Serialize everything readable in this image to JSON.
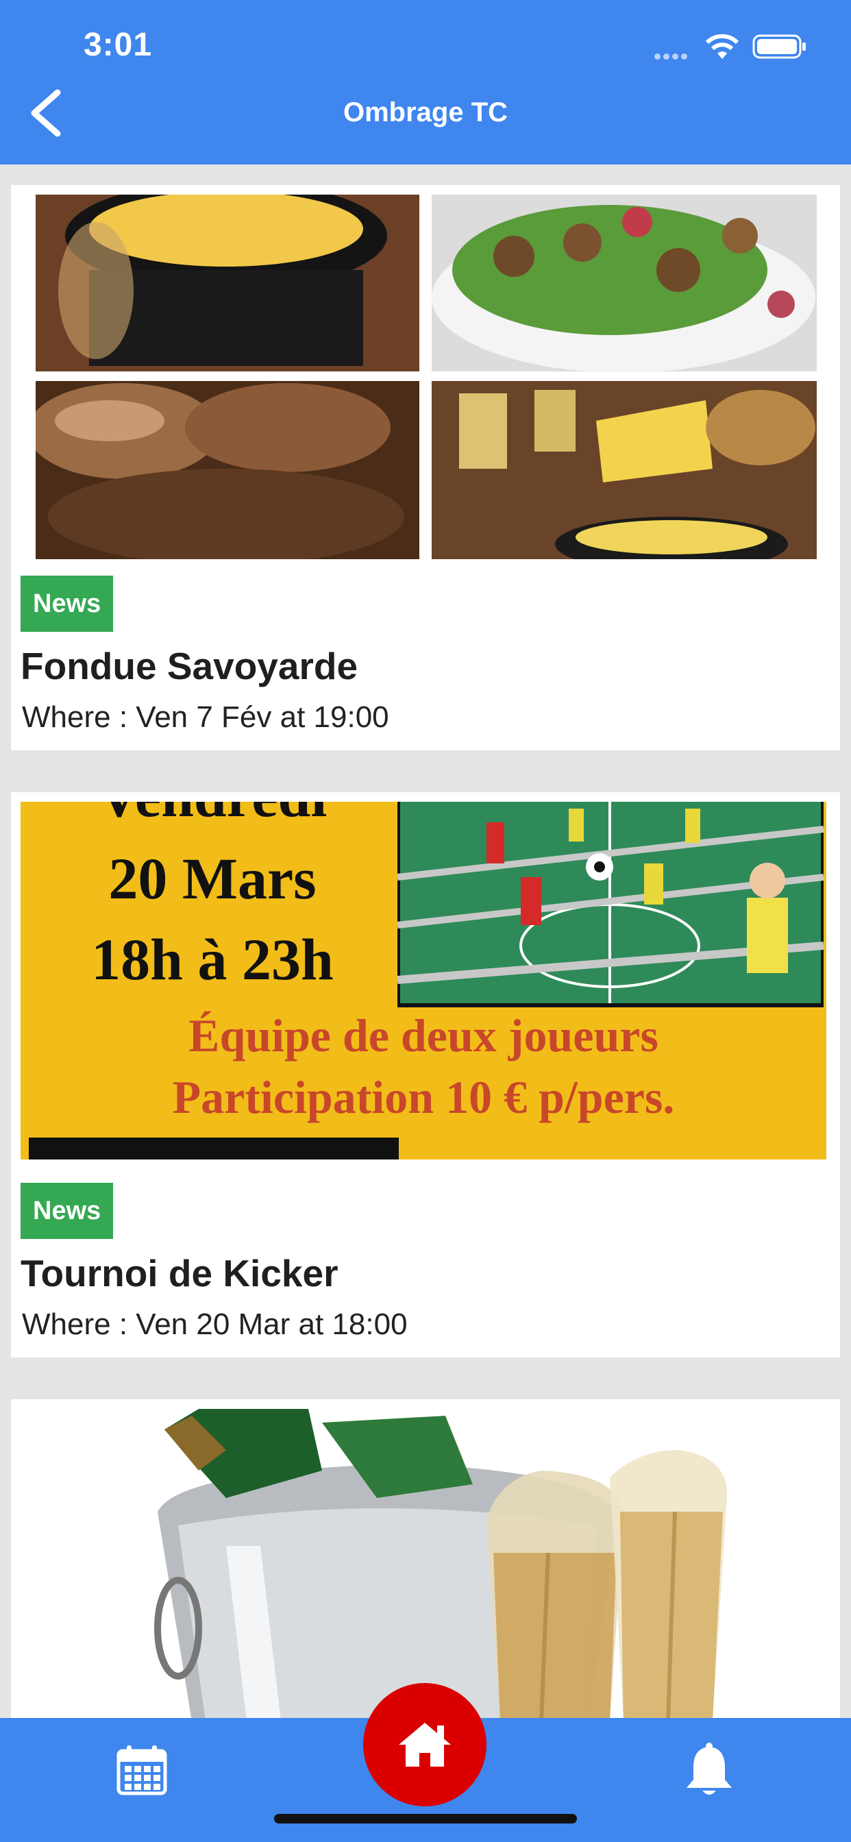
{
  "status_bar": {
    "time": "3:01"
  },
  "header": {
    "title": "Ombrage TC"
  },
  "cards": [
    {
      "badge": "News",
      "title": "Fondue Savoyarde",
      "where": "Where : Ven 7 Fév at 19:00"
    },
    {
      "badge": "News",
      "title": "Tournoi de Kicker",
      "where": "Where : Ven 20 Mar at 18:00",
      "poster": {
        "line1": "Vendredi",
        "line2": "20 Mars",
        "line3": "18h à 23h",
        "line4": "Équipe de deux joueurs",
        "line5": "Participation 10 € p/pers."
      }
    },
    {
      "image": "champagne-bucket"
    }
  ],
  "bottom_nav": {
    "icons": [
      "calendar-icon",
      "home-icon",
      "bell-icon"
    ]
  },
  "colors": {
    "header": "#3f86ee",
    "badge": "#34a853",
    "home": "#da0000",
    "poster_bg": "#f2bd18"
  }
}
